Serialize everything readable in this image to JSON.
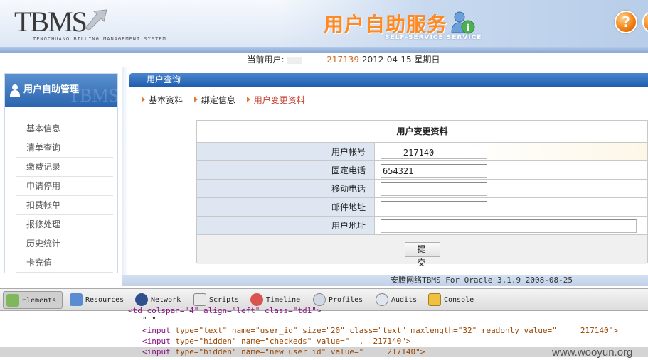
{
  "header": {
    "logo_text": "TBMS",
    "logo_subtitle": "TENGCHUANG BILLING MANAGEMENT SYSTEM",
    "service_title": "用户自助服务",
    "service_subtitle": "SELF-SERVICE SERVICE",
    "help_label": "?"
  },
  "userbar": {
    "label": "当前用户:",
    "user_id": "217139",
    "date": "2012-04-15",
    "weekday": "星期日"
  },
  "sidebar": {
    "title": "用户自助管理",
    "watermark": "TBMS",
    "items": [
      {
        "label": "基本信息"
      },
      {
        "label": "清单查询"
      },
      {
        "label": "缴费记录"
      },
      {
        "label": "申请停用"
      },
      {
        "label": "扣费帐单"
      },
      {
        "label": "报修处理"
      },
      {
        "label": "历史统计"
      },
      {
        "label": "卡充值"
      }
    ]
  },
  "panel": {
    "title": "用户查询",
    "tabs": [
      {
        "label": "基本资料",
        "active": false
      },
      {
        "label": "绑定信息",
        "active": false
      },
      {
        "label": "用户变更资料",
        "active": true
      }
    ]
  },
  "form": {
    "title": "用户变更资料",
    "fields": [
      {
        "label": "用户帐号",
        "value": "    217140"
      },
      {
        "label": "固定电话",
        "value": "654321"
      },
      {
        "label": "移动电话",
        "value": ""
      },
      {
        "label": "邮件地址",
        "value": ""
      },
      {
        "label": "用户地址",
        "value": ""
      }
    ],
    "submit_label": "提 交"
  },
  "footer": {
    "text": "安腾网络TBMS For Oracle 3.1.9 2008-08-25"
  },
  "devtools": {
    "tabs": [
      {
        "label": "Elements",
        "icon": "elements-icon",
        "active": true
      },
      {
        "label": "Resources",
        "icon": "resources-icon"
      },
      {
        "label": "Network",
        "icon": "network-icon"
      },
      {
        "label": "Scripts",
        "icon": "scripts-icon"
      },
      {
        "label": "Timeline",
        "icon": "timeline-icon"
      },
      {
        "label": "Profiles",
        "icon": "profiles-icon"
      },
      {
        "label": "Audits",
        "icon": "audits-icon"
      },
      {
        "label": "Console",
        "icon": "console-icon"
      }
    ],
    "code_lines": {
      "line0": "<td colspan=\"4\" align=\"left\" class=\"td1\">",
      "line1": "\" \"",
      "line2_tag": "<input",
      "line2_attrs": " type=\"text\" name=\"user_id\" size=\"20\" class=\"text\" maxlength=\"32\" readonly value=\"     217140\">",
      "line3_tag": "<input",
      "line3_attrs": " type=\"hidden\" name=\"checkeds\" value=\"  ,  217140\">",
      "line4_tag": "<input",
      "line4_attrs": " type=\"hidden\" name=\"new_user_id\" value=\"     217140\">"
    }
  },
  "watermark": "www.wooyun.org"
}
